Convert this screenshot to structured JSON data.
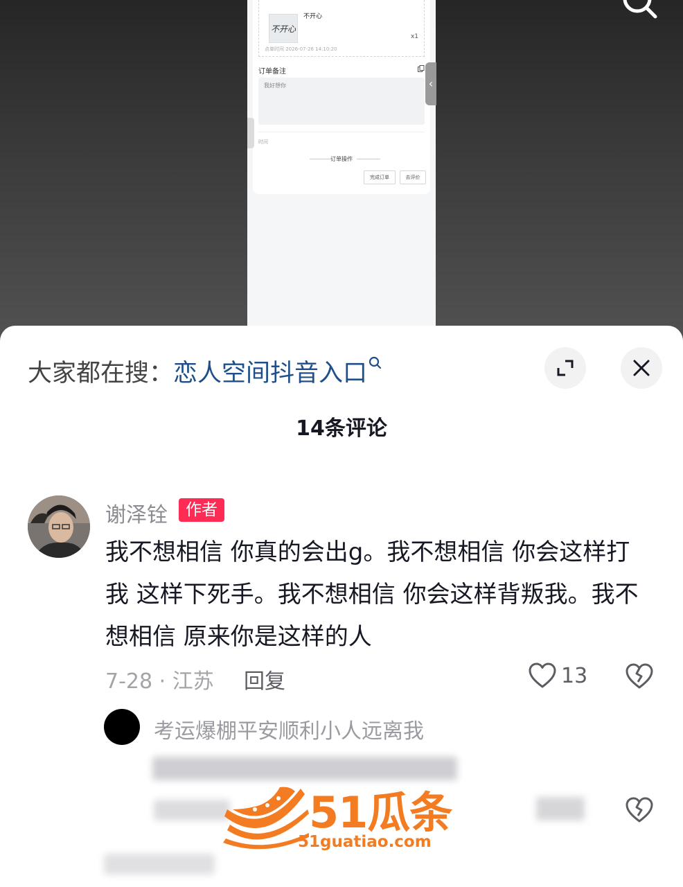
{
  "video_screenshot": {
    "item_title": "不开心",
    "item_qty": "x1",
    "order_time": "点单时间 2026-07-26 14:10:20",
    "remark_label": "订单备注",
    "remark_text": "我好想你",
    "misc_text": "时间",
    "ops_title": "订单操作",
    "buttons": [
      "完成订单",
      "去评价"
    ],
    "thumb_text": "不开心"
  },
  "search_hint": {
    "prefix": "大家都在搜：",
    "query": "恋人空间抖音入口"
  },
  "comments_header": {
    "count_label": "14条评论"
  },
  "comment": {
    "username": "谢泽铨",
    "author_tag": "作者",
    "text": "我不想相信 你真的会出g。我不想相信 你会这样打我 这样下死手。我不想相信 你会这样背叛我。我不想相信 原来你是这样的人",
    "meta": "7-28 · 江苏",
    "reply_label": "回复",
    "like_count": "13"
  },
  "reply": {
    "username": "考运爆棚平安顺利小人远离我"
  },
  "watermark": {
    "name": "51瓜条",
    "url": "51guatiao.com"
  },
  "colors": {
    "author_tag": "#fe2c55",
    "search_link": "#1f4f8a",
    "watermark": "#f37c22"
  }
}
